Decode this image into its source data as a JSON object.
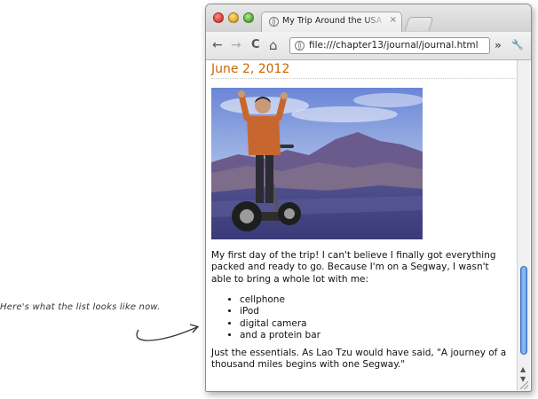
{
  "annotation": {
    "text": "Here's what the list looks like now."
  },
  "browser": {
    "tab_title": "My Trip Around the USA on a Segway",
    "tab_close": "×",
    "nav": {
      "back": "←",
      "forward": "→",
      "reload": "C",
      "home": "⌂",
      "more": "»",
      "wrench": "🔧"
    },
    "address": "file:///chapter13/journal/journal.html"
  },
  "page": {
    "date": "June 2, 2012",
    "paragraph1": "My first day of the trip! I can't believe I finally got everything packed and ready to go. Because I'm on a Segway, I wasn't able to bring a whole lot with me:",
    "items": [
      "cellphone",
      "iPod",
      "digital camera",
      "and a protein bar"
    ],
    "paragraph2": "Just the essentials. As Lao Tzu would have said, \"A journey of a thousand miles begins with one Segway.\""
  },
  "scroll": {
    "position": 0.85
  }
}
